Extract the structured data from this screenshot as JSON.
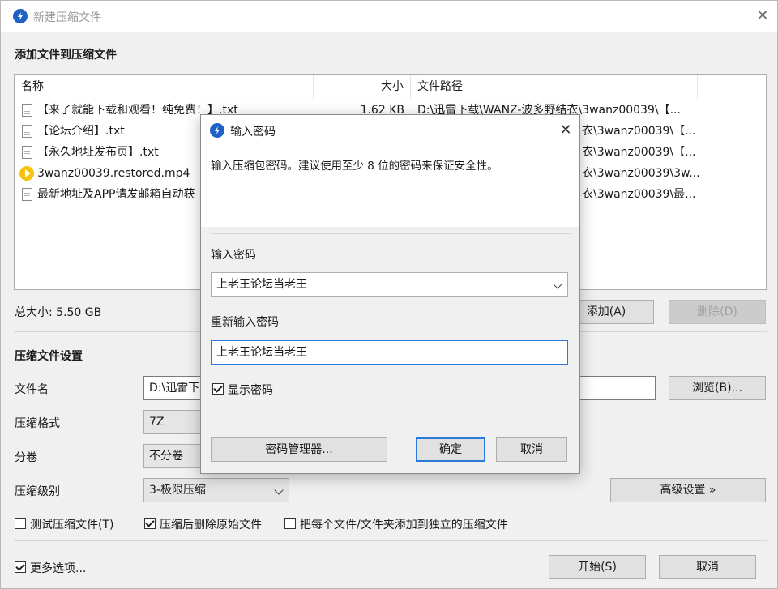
{
  "window": {
    "title": "新建压缩文件",
    "add_section_title": "添加文件到压缩文件",
    "columns": {
      "name": "名称",
      "size": "大小",
      "path": "文件路径"
    },
    "files": [
      {
        "name": "【来了就能下载和观看！纯免费！】.txt",
        "size": "1.62 KB",
        "path": "D:\\迅雷下载\\WANZ-波多野结衣\\3wanz00039\\【...",
        "icon": "text-file-icon"
      },
      {
        "name": "【论坛介绍】.txt",
        "size": "",
        "path": "衣\\3wanz00039\\【...",
        "icon": "text-file-icon"
      },
      {
        "name": "【永久地址发布页】.txt",
        "size": "",
        "path": "衣\\3wanz00039\\【...",
        "icon": "text-file-icon"
      },
      {
        "name": "3wanz00039.restored.mp4",
        "size": "",
        "path": "衣\\3wanz00039\\3w...",
        "icon": "video-file-icon"
      },
      {
        "name": "最新地址及APP请发邮箱自动获",
        "size": "",
        "path": "衣\\3wanz00039\\最...",
        "icon": "text-file-icon"
      }
    ],
    "total_size": "总大小: 5.50 GB",
    "add_button": "添加(A)",
    "delete_button": "删除(D)",
    "settings_title": "压缩文件设置",
    "filename_label": "文件名",
    "filename_value": "D:\\迅雷下",
    "browse_button": "浏览(B)...",
    "format_label": "压缩格式",
    "format_value": "7Z",
    "volume_label": "分卷",
    "volume_value": "不分卷",
    "level_label": "压缩级别",
    "level_value": "3-极限压缩",
    "advanced_button": "高级设置 »",
    "test_archive": "测试压缩文件(T)",
    "delete_after": "压缩后删除原始文件",
    "each_separate": "把每个文件/文件夹添加到独立的压缩文件",
    "more_options": "更多选项...",
    "start_button": "开始(S)",
    "cancel_button": "取消",
    "test_archive_checked": false,
    "delete_after_checked": true,
    "each_separate_checked": false,
    "more_options_checked": true
  },
  "dialog": {
    "title": "输入密码",
    "description": "输入压缩包密码。建议使用至少 8 位的密码来保证安全性。",
    "password_label": "输入密码",
    "password_value": "上老王论坛当老王",
    "confirm_label": "重新输入密码",
    "confirm_value": "上老王论坛当老王",
    "show_password": "显示密码",
    "show_password_checked": true,
    "manager_button": "密码管理器...",
    "ok_button": "确定",
    "cancel_button": "取消"
  },
  "colors": {
    "accent": "#2b7ad9",
    "app_icon": "#1f62c6",
    "video_icon": "#f6c30a"
  }
}
